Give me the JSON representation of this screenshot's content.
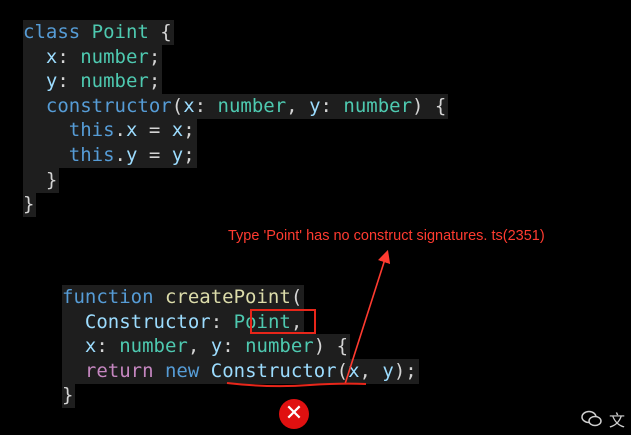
{
  "code_top": [
    {
      "tokens": [
        {
          "t": "class",
          "c": "kw"
        },
        {
          "t": " ",
          "c": "plain"
        },
        {
          "t": "Point",
          "c": "type"
        },
        {
          "t": " {",
          "c": "plain"
        }
      ]
    },
    {
      "tokens": [
        {
          "t": "  ",
          "c": "plain"
        },
        {
          "t": "x",
          "c": "var"
        },
        {
          "t": ": ",
          "c": "plain"
        },
        {
          "t": "number",
          "c": "type"
        },
        {
          "t": ";",
          "c": "plain"
        }
      ]
    },
    {
      "tokens": [
        {
          "t": "  ",
          "c": "plain"
        },
        {
          "t": "y",
          "c": "var"
        },
        {
          "t": ": ",
          "c": "plain"
        },
        {
          "t": "number",
          "c": "type"
        },
        {
          "t": ";",
          "c": "plain"
        }
      ]
    },
    {
      "tokens": [
        {
          "t": "  ",
          "c": "plain"
        },
        {
          "t": "constructor",
          "c": "kw"
        },
        {
          "t": "(",
          "c": "plain"
        },
        {
          "t": "x",
          "c": "var"
        },
        {
          "t": ": ",
          "c": "plain"
        },
        {
          "t": "number",
          "c": "type"
        },
        {
          "t": ", ",
          "c": "plain"
        },
        {
          "t": "y",
          "c": "var"
        },
        {
          "t": ": ",
          "c": "plain"
        },
        {
          "t": "number",
          "c": "type"
        },
        {
          "t": ") {",
          "c": "plain"
        }
      ]
    },
    {
      "tokens": [
        {
          "t": "    ",
          "c": "plain"
        },
        {
          "t": "this",
          "c": "kw"
        },
        {
          "t": ".",
          "c": "plain"
        },
        {
          "t": "x",
          "c": "var"
        },
        {
          "t": " = ",
          "c": "plain"
        },
        {
          "t": "x",
          "c": "var"
        },
        {
          "t": ";",
          "c": "plain"
        }
      ]
    },
    {
      "tokens": [
        {
          "t": "    ",
          "c": "plain"
        },
        {
          "t": "this",
          "c": "kw"
        },
        {
          "t": ".",
          "c": "plain"
        },
        {
          "t": "y",
          "c": "var"
        },
        {
          "t": " = ",
          "c": "plain"
        },
        {
          "t": "y",
          "c": "var"
        },
        {
          "t": ";",
          "c": "plain"
        }
      ]
    },
    {
      "tokens": [
        {
          "t": "  }",
          "c": "plain"
        }
      ]
    },
    {
      "tokens": [
        {
          "t": "}",
          "c": "plain"
        }
      ]
    }
  ],
  "code_bottom": [
    {
      "tokens": [
        {
          "t": "function",
          "c": "kw"
        },
        {
          "t": " ",
          "c": "plain"
        },
        {
          "t": "createPoint",
          "c": "fn"
        },
        {
          "t": "(",
          "c": "plain"
        }
      ]
    },
    {
      "tokens": [
        {
          "t": "  ",
          "c": "plain"
        },
        {
          "t": "Constructor",
          "c": "var"
        },
        {
          "t": ": ",
          "c": "plain"
        },
        {
          "t": "Point",
          "c": "type"
        },
        {
          "t": ",",
          "c": "plain"
        }
      ]
    },
    {
      "tokens": [
        {
          "t": "  ",
          "c": "plain"
        },
        {
          "t": "x",
          "c": "var"
        },
        {
          "t": ": ",
          "c": "plain"
        },
        {
          "t": "number",
          "c": "type"
        },
        {
          "t": ", ",
          "c": "plain"
        },
        {
          "t": "y",
          "c": "var"
        },
        {
          "t": ": ",
          "c": "plain"
        },
        {
          "t": "number",
          "c": "type"
        },
        {
          "t": ") {",
          "c": "plain"
        }
      ]
    },
    {
      "tokens": [
        {
          "t": "  ",
          "c": "plain"
        },
        {
          "t": "return",
          "c": "ctl"
        },
        {
          "t": " ",
          "c": "plain"
        },
        {
          "t": "new",
          "c": "kw"
        },
        {
          "t": " ",
          "c": "plain"
        },
        {
          "t": "Constructor",
          "c": "var"
        },
        {
          "t": "(",
          "c": "plain"
        },
        {
          "t": "x",
          "c": "var"
        },
        {
          "t": ", ",
          "c": "plain"
        },
        {
          "t": "y",
          "c": "var"
        },
        {
          "t": ");",
          "c": "plain"
        }
      ]
    },
    {
      "tokens": [
        {
          "t": "}",
          "c": "plain"
        }
      ]
    }
  ],
  "annotation": "Type 'Point' has no construct signatures. ts(2351)",
  "error_icon": "close-icon",
  "error_symbol": "✕",
  "watermark_icon": "wechat-icon",
  "watermark_text": "文",
  "colors": {
    "error": "#e8261a",
    "bg": "#000000",
    "code_bg": "#1e1e1e"
  }
}
